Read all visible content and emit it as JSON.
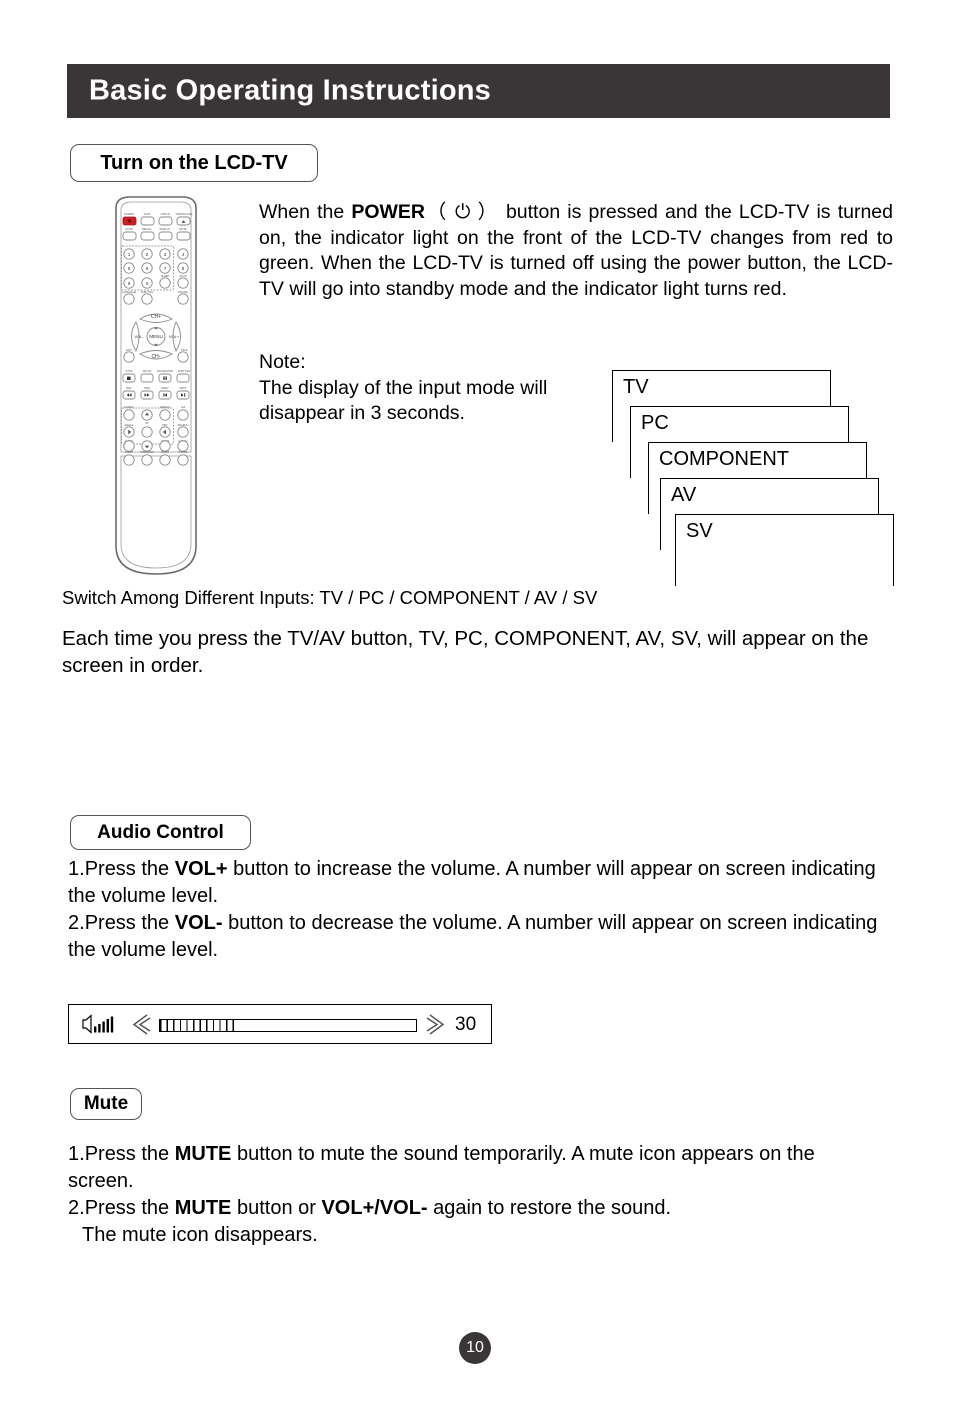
{
  "page": {
    "title": "Basic Operating Instructions",
    "number": "10"
  },
  "sections": {
    "turn_on": {
      "label": "Turn on the LCD-TV",
      "power_paragraph": {
        "prefix": "When the ",
        "bold": "POWER",
        "symbol": "（ ⏻ ）",
        "rest": "button is pressed and the LCD-TV is turned on, the indicator light on the front of the LCD-TV changes from red to green.  When the LCD-TV is turned off using the power button, the LCD-TV will go into standby mode and the indicator light turns red."
      },
      "note_title": "Note:",
      "note_body": "The display of the input mode will disappear in 3 seconds.",
      "input_modes": [
        "TV",
        "PC",
        "COMPONENT",
        "AV",
        "SV"
      ],
      "switch_line": "Switch Among Different Inputs: TV / PC / COMPONENT / AV / SV",
      "each_time_line": "Each time you press the TV/AV button, TV,  PC, COMPONENT, AV, SV, will appear on the screen in order."
    },
    "audio_control": {
      "label": "Audio Control",
      "items": [
        {
          "number": "1.",
          "prefix": "Press the ",
          "bold": "VOL+",
          "rest": " button to increase the volume. A number will appear on screen indicating the volume level."
        },
        {
          "number": "2.",
          "prefix": "Press the ",
          "bold": "VOL-",
          "rest": " button to decrease the volume. A number will appear on screen indicating the volume level."
        }
      ],
      "osd": {
        "speaker_icon": "speaker-volume-icon",
        "prev_icon": "double-chevron-left-icon",
        "next_icon": "double-chevron-right-icon",
        "level": "30",
        "fill_percent": 29
      }
    },
    "mute": {
      "label": "Mute",
      "items": [
        {
          "number": "1.",
          "prefix": "Press the ",
          "bold": "MUTE",
          "rest": " button to mute the sound temporarily. A mute icon appears on the screen.",
          "continuation": "appears on the screen."
        },
        {
          "number": "2.",
          "prefix": "Press the ",
          "bold": "MUTE",
          "middle": " button or ",
          "bold2": "VOL+/VOL-",
          "rest": " again to restore the sound.",
          "continuation": "The mute icon disappears."
        }
      ]
    }
  },
  "remote": {
    "name": "remote-control-illustration",
    "rows": [
      {
        "labels": [
          "POWER",
          "TV/AV",
          "TV/DVD",
          "OPEN/CLOSE"
        ]
      },
      {
        "labels": [
          "SCAN",
          "RECALL",
          "DISPLAY",
          "MUTE"
        ]
      },
      {
        "labels": [
          "1",
          "2",
          "3",
          "4"
        ]
      },
      {
        "labels": [
          "5",
          "6",
          "7",
          "8"
        ]
      },
      {
        "labels": [
          "9",
          "0",
          "SLEEP",
          "GOTO"
        ]
      },
      {
        "labels": [
          "LANGUAGE",
          "SUBTITLE",
          "",
          "P.MODE"
        ]
      },
      {
        "labels": [
          "CH+",
          "VOL-",
          "MENU",
          "VOL+",
          "CH-",
          "EXIT",
          "TITLE"
        ]
      },
      {
        "labels": [
          "STOP",
          "SETUP",
          "PAUSE/STEP",
          "SUBTITLE"
        ]
      },
      {
        "labels": [
          "REV",
          "FWD",
          "PREV",
          "NEXT"
        ]
      },
      {
        "labels": [
          "S.MENU",
          "REPEAT",
          "A-B"
        ]
      },
      {
        "labels": [
          "ANGLE",
          "SLOW",
          "PBC",
          "SEARCH"
        ]
      },
      {
        "labels": [
          "AUDIO",
          "PROGRAM",
          "ZOOM",
          "D-DISC"
        ]
      }
    ],
    "colors": {
      "power_button": "#cc2222",
      "body": "#ffffff",
      "stroke": "#6b6b6b"
    }
  },
  "colors": {
    "header_bg": "#3a3537",
    "header_text": "#ffffff",
    "page_badge_bg": "#3a3537",
    "body_text": "#000000",
    "pill_border": "#555555"
  }
}
